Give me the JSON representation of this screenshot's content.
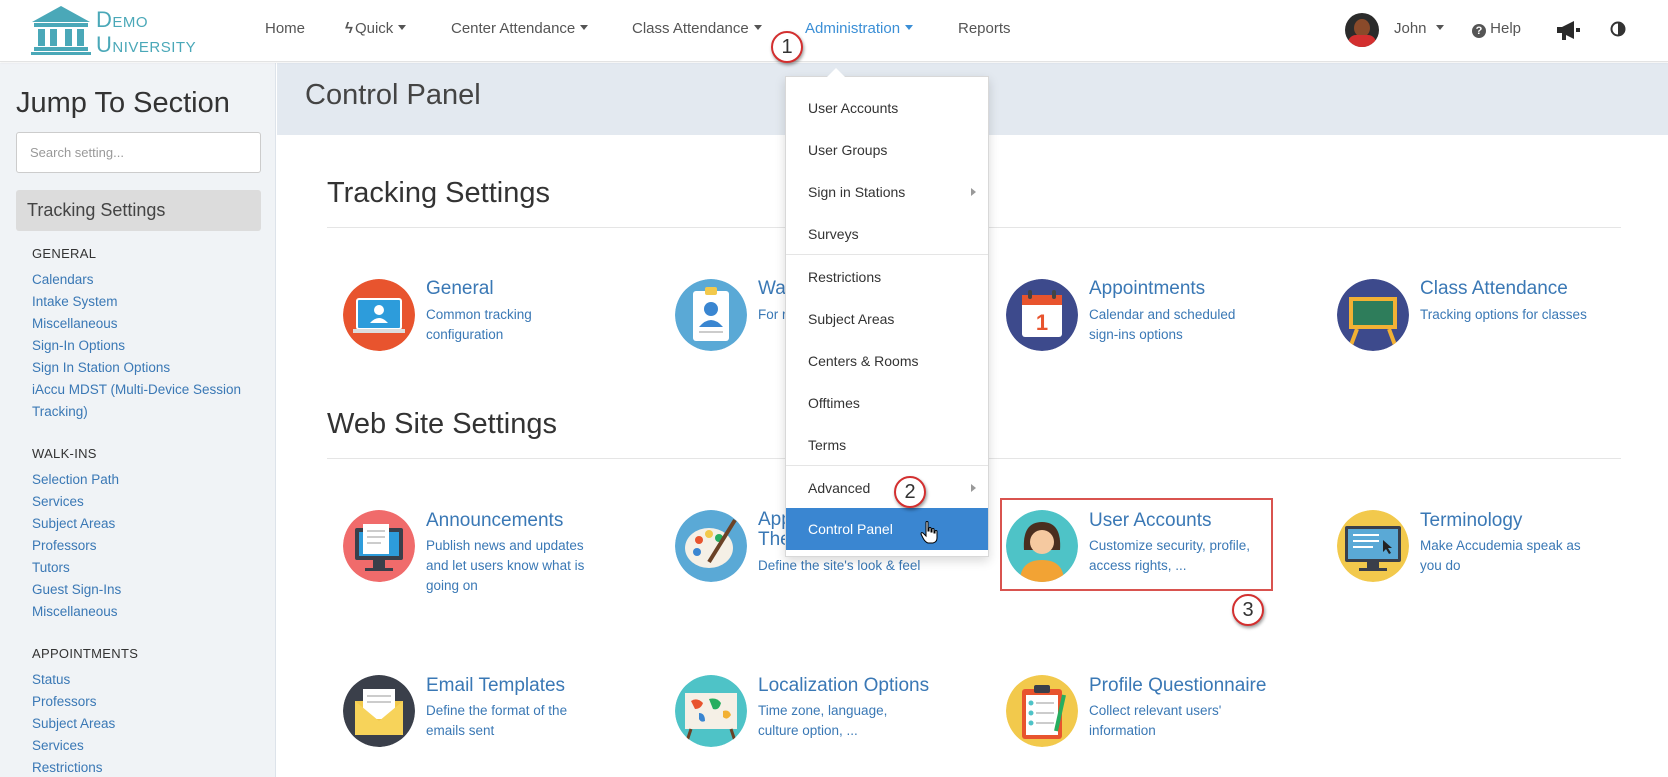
{
  "brand": {
    "line1": "Demo",
    "line2": "University"
  },
  "nav": {
    "items": [
      {
        "label": "Home",
        "caret": false
      },
      {
        "label": "Quick",
        "caret": true,
        "icon": "bolt-icon"
      },
      {
        "label": "Center Attendance",
        "caret": true
      },
      {
        "label": "Class Attendance",
        "caret": true
      },
      {
        "label": "Administration",
        "caret": true,
        "active": true
      },
      {
        "label": "Reports",
        "caret": false
      }
    ],
    "user": "John",
    "help": "Help"
  },
  "sidebar": {
    "title": "Jump To Section",
    "search_placeholder": "Search setting...",
    "current_section": "Tracking Settings",
    "groups": [
      {
        "title": "GENERAL",
        "links": [
          "Calendars",
          "Intake System",
          "Miscellaneous",
          "Sign-In Options",
          "Sign In Station Options",
          "iAccu MDST (Multi-Device Session",
          "Tracking)"
        ]
      },
      {
        "title": "WALK-INS",
        "links": [
          "Selection Path",
          "Services",
          "Subject Areas",
          "Professors",
          "Tutors",
          "Guest Sign-Ins",
          "Miscellaneous"
        ]
      },
      {
        "title": "APPOINTMENTS",
        "links": [
          "Status",
          "Professors",
          "Subject Areas",
          "Services",
          "Restrictions"
        ]
      }
    ]
  },
  "main": {
    "page_title": "Control Panel",
    "sections": [
      {
        "title": "Tracking Settings",
        "cards": [
          {
            "title": "General",
            "desc": [
              "Common tracking",
              "configuration"
            ]
          },
          {
            "title": "Wa",
            "desc": [
              "For r"
            ]
          },
          {
            "title": "Appointments",
            "desc": [
              "Calendar and scheduled",
              "sign-ins options"
            ]
          },
          {
            "title": "Class Attendance",
            "desc": [
              "Tracking options for classes"
            ]
          }
        ]
      },
      {
        "title": "Web Site Settings",
        "cards": [
          {
            "title": "Announcements",
            "desc": [
              "Publish news and updates",
              "and let users know what is",
              "going on"
            ]
          },
          {
            "title": "App",
            "title2": "The",
            "desc": [
              "Define the site's look & feel"
            ]
          },
          {
            "title": "User Accounts",
            "desc": [
              "Customize security, profile,",
              "access rights, ..."
            ]
          },
          {
            "title": "Terminology",
            "desc": [
              "Make Accudemia speak as",
              "you do"
            ]
          },
          {
            "title": "Email Templates",
            "desc": [
              "Define the format of the",
              "emails sent"
            ]
          },
          {
            "title": "Localization Options",
            "desc": [
              "Time zone, language,",
              "culture option, ..."
            ]
          },
          {
            "title": "Profile Questionnaire",
            "desc": [
              "Collect relevant users'",
              "information"
            ]
          }
        ]
      }
    ]
  },
  "dropdown": {
    "items": [
      "User Accounts",
      "User Groups",
      "Sign in Stations",
      "Surveys",
      "Restrictions",
      "Subject Areas",
      "Centers & Rooms",
      "Offtimes",
      "Terms",
      "Advanced",
      "Control Panel"
    ],
    "active": "Control Panel"
  },
  "annotations": {
    "step1": "1",
    "step2": "2",
    "step3": "3"
  },
  "colors": {
    "link": "#3a78b5",
    "active": "#3a86d1",
    "header_bg": "#e3e9f0",
    "annotation": "#d32f2f"
  }
}
